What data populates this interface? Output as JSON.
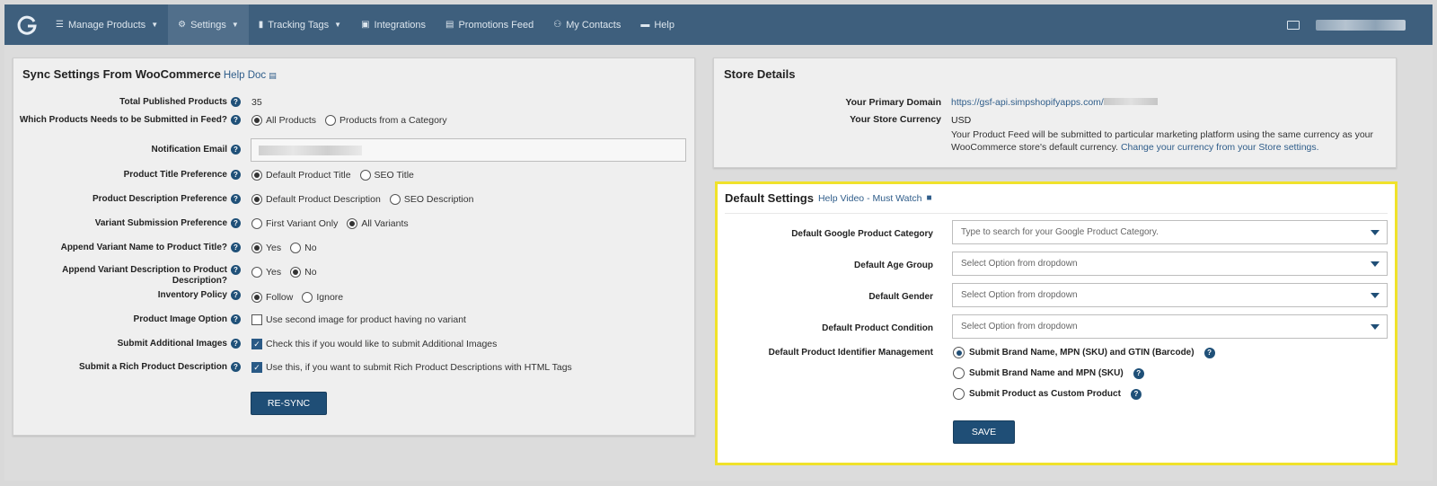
{
  "nav": {
    "logo": "G",
    "items": [
      {
        "label": "Manage Products",
        "icon": "list-icon",
        "dropdown": true
      },
      {
        "label": "Settings",
        "icon": "gear-icon",
        "dropdown": true,
        "active": true
      },
      {
        "label": "Tracking Tags",
        "icon": "bar-chart-icon",
        "dropdown": true
      },
      {
        "label": "Integrations",
        "icon": "briefcase-icon",
        "dropdown": false
      },
      {
        "label": "Promotions Feed",
        "icon": "document-icon",
        "dropdown": false
      },
      {
        "label": "My Contacts",
        "icon": "people-icon",
        "dropdown": false
      },
      {
        "label": "Help",
        "icon": "chat-icon",
        "dropdown": false
      }
    ]
  },
  "sync": {
    "title": "Sync Settings From WooCommerce",
    "help_doc": "Help Doc",
    "rows": {
      "total_published": {
        "label": "Total Published Products",
        "value": "35"
      },
      "which_products": {
        "label": "Which Products Needs to be Submitted in Feed?",
        "opt1": "All Products",
        "opt2": "Products from a Category"
      },
      "notification_email": {
        "label": "Notification Email"
      },
      "title_pref": {
        "label": "Product Title Preference",
        "opt1": "Default Product Title",
        "opt2": "SEO Title"
      },
      "desc_pref": {
        "label": "Product Description Preference",
        "opt1": "Default Product Description",
        "opt2": "SEO Description"
      },
      "variant_pref": {
        "label": "Variant Submission Preference",
        "opt1": "First Variant Only",
        "opt2": "All Variants"
      },
      "append_name": {
        "label": "Append Variant Name to Product Title?",
        "opt1": "Yes",
        "opt2": "No"
      },
      "append_desc": {
        "label": "Append Variant Description to Product Description?",
        "opt1": "Yes",
        "opt2": "No"
      },
      "inventory": {
        "label": "Inventory Policy",
        "opt1": "Follow",
        "opt2": "Ignore"
      },
      "image_option": {
        "label": "Product Image Option",
        "text": "Use second image for product having no variant"
      },
      "additional_images": {
        "label": "Submit Additional Images",
        "text": "Check this if you would like to submit Additional Images"
      },
      "rich_desc": {
        "label": "Submit a Rich Product Description",
        "text": "Use this, if you want to submit Rich Product Descriptions with HTML Tags"
      }
    },
    "button": "RE-SYNC"
  },
  "store": {
    "title": "Store Details",
    "domain_label": "Your Primary Domain",
    "domain_value": "https://gsf-api.simpshopifyapps.com/",
    "currency_label": "Your Store Currency",
    "currency_value": "USD",
    "currency_note": "Your Product Feed will be submitted to particular marketing platform using the same currency as your WooCommerce store's default currency.",
    "currency_link": "Change your currency from your Store settings."
  },
  "defaults": {
    "title": "Default Settings",
    "help_video": "Help Video - Must Watch",
    "category_label": "Default Google Product Category",
    "category_placeholder": "Type to search for your Google Product Category.",
    "age_label": "Default Age Group",
    "age_value": "Select Option from dropdown",
    "gender_label": "Default Gender",
    "gender_value": "Select Option from dropdown",
    "condition_label": "Default Product Condition",
    "condition_value": "Select Option from dropdown",
    "identifier_label": "Default Product Identifier Management",
    "id_opt1": "Submit Brand Name, MPN (SKU) and GTIN (Barcode)",
    "id_opt2": "Submit Brand Name and MPN (SKU)",
    "id_opt3": "Submit Product as Custom Product",
    "button": "SAVE"
  },
  "colors": {
    "nav_bg": "#3e5f7d",
    "accent": "#1f4e76",
    "highlight": "#f0e22a"
  }
}
